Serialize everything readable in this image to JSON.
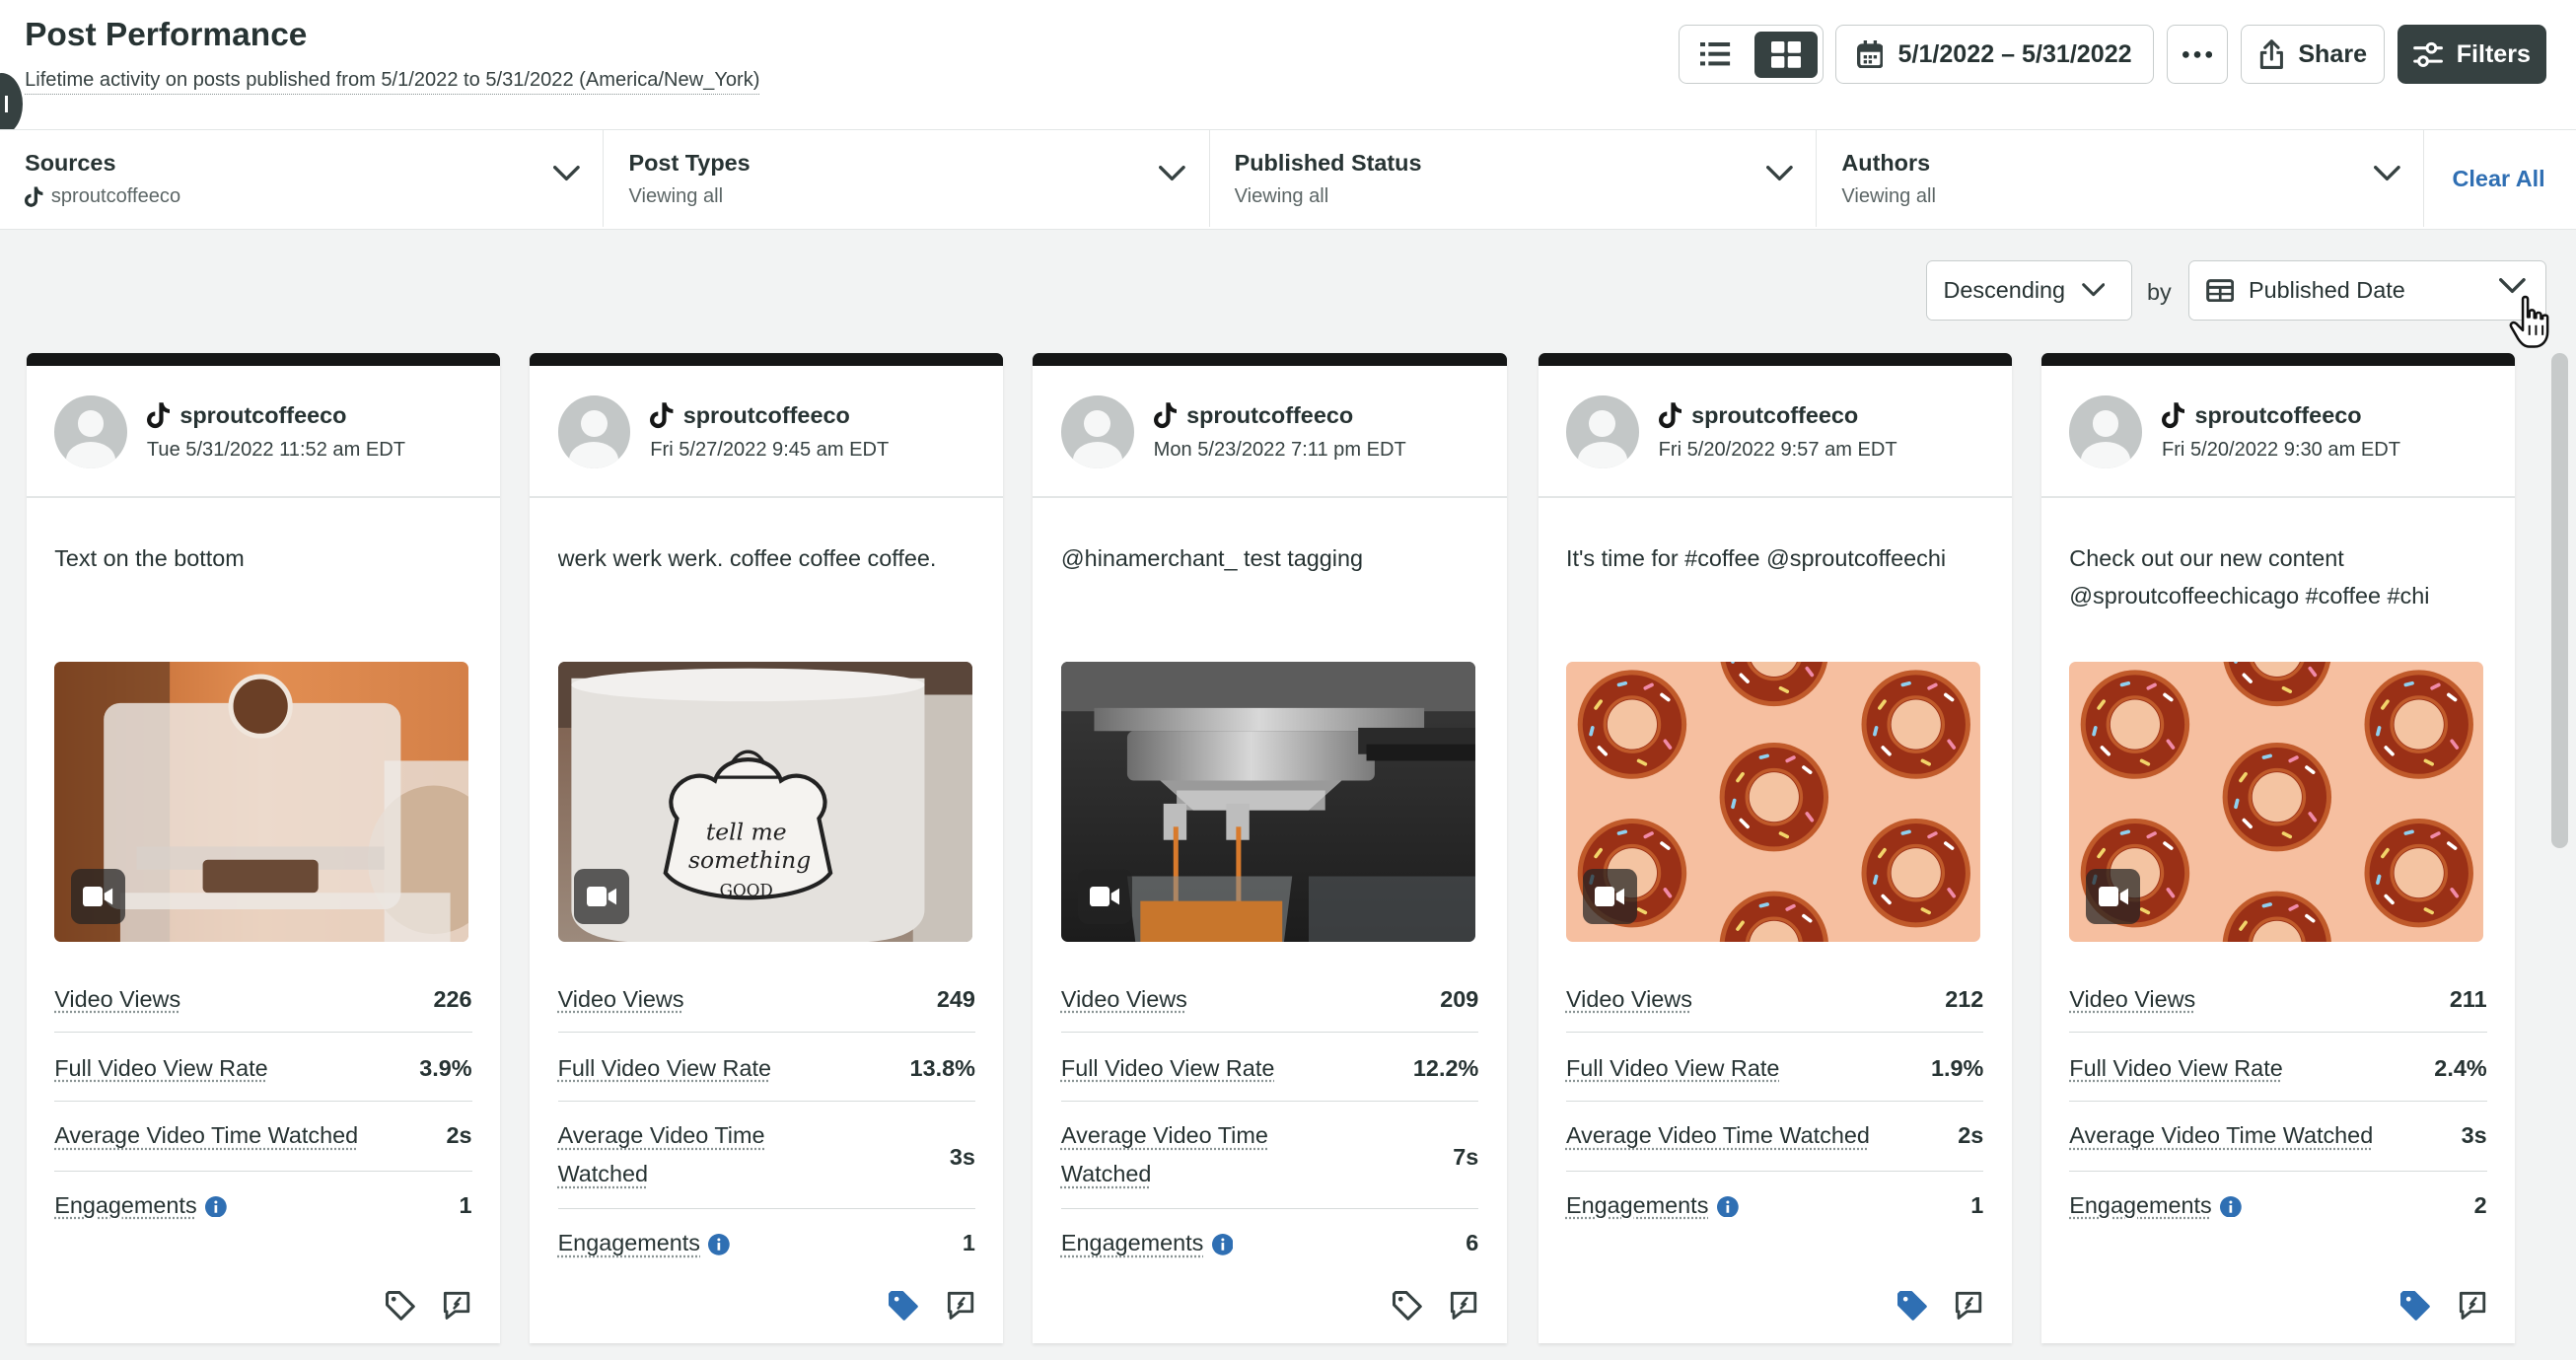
{
  "header": {
    "title": "Post Performance",
    "subtitle": "Lifetime activity on posts published from 5/1/2022 to 5/31/2022 (America/New_York)",
    "date_range": "5/1/2022 – 5/31/2022",
    "share_label": "Share",
    "filters_label": "Filters"
  },
  "filters": [
    {
      "label": "Sources",
      "value": "sproutcoffeeco",
      "has_tiktok_icon": true
    },
    {
      "label": "Post Types",
      "value": "Viewing all"
    },
    {
      "label": "Published Status",
      "value": "Viewing all"
    },
    {
      "label": "Authors",
      "value": "Viewing all"
    }
  ],
  "clear_all": "Clear All",
  "sort": {
    "order": "Descending",
    "by_label": "by",
    "field": "Published Date"
  },
  "colors": {
    "accent_dark": "#364141",
    "link_blue": "#2f6fb3",
    "tag_blue": "#2f6fb3"
  },
  "cards": [
    {
      "account": "sproutcoffeeco",
      "date": "Tue 5/31/2022 11:52 am EDT",
      "text_lines": [
        "Text on the bottom"
      ],
      "media": "coffee-cup-overlay",
      "metrics": [
        {
          "label": "Video Views",
          "value": "226"
        },
        {
          "label": "Full Video View Rate",
          "value": "3.9%"
        },
        {
          "label": "Average Video Time Watched",
          "value": "2s"
        },
        {
          "label": "Engagements",
          "value": "1"
        }
      ],
      "tagged": false
    },
    {
      "account": "sproutcoffeeco",
      "date": "Fri 5/27/2022 9:45 am EDT",
      "text_lines": [
        "werk werk werk. coffee coffee coffee."
      ],
      "media": "mug",
      "mug_text": [
        "tell me",
        "something",
        "GOOD"
      ],
      "metrics": [
        {
          "label": "Video Views",
          "value": "249"
        },
        {
          "label": "Full Video View Rate",
          "value": "13.8%"
        },
        {
          "label": "Average Video Time Watched",
          "value": "3s",
          "label_lines": [
            "Average Video Time",
            "Watched"
          ]
        },
        {
          "label": "Engagements",
          "value": "1"
        }
      ],
      "tagged": true
    },
    {
      "account": "sproutcoffeeco",
      "date": "Mon 5/23/2022 7:11 pm EDT",
      "text_lines": [
        "@hinamerchant_ test tagging"
      ],
      "media": "espresso",
      "metrics": [
        {
          "label": "Video Views",
          "value": "209"
        },
        {
          "label": "Full Video View Rate",
          "value": "12.2%"
        },
        {
          "label": "Average Video Time Watched",
          "value": "7s",
          "label_lines": [
            "Average Video Time",
            "Watched"
          ]
        },
        {
          "label": "Engagements",
          "value": "6"
        }
      ],
      "tagged": false
    },
    {
      "account": "sproutcoffeeco",
      "date": "Fri 5/20/2022 9:57 am EDT",
      "text_lines": [
        "It's time for #coffee @sproutcoffeechi"
      ],
      "media": "donuts",
      "metrics": [
        {
          "label": "Video Views",
          "value": "212"
        },
        {
          "label": "Full Video View Rate",
          "value": "1.9%"
        },
        {
          "label": "Average Video Time Watched",
          "value": "2s"
        },
        {
          "label": "Engagements",
          "value": "1"
        }
      ],
      "tagged": true
    },
    {
      "account": "sproutcoffeeco",
      "date": "Fri 5/20/2022 9:30 am EDT",
      "text_lines": [
        "Check out our new content",
        "@sproutcoffeechicago #coffee #chi"
      ],
      "media": "donuts",
      "metrics": [
        {
          "label": "Video Views",
          "value": "211"
        },
        {
          "label": "Full Video View Rate",
          "value": "2.4%"
        },
        {
          "label": "Average Video Time Watched",
          "value": "3s"
        },
        {
          "label": "Engagements",
          "value": "2"
        }
      ],
      "tagged": true
    }
  ]
}
